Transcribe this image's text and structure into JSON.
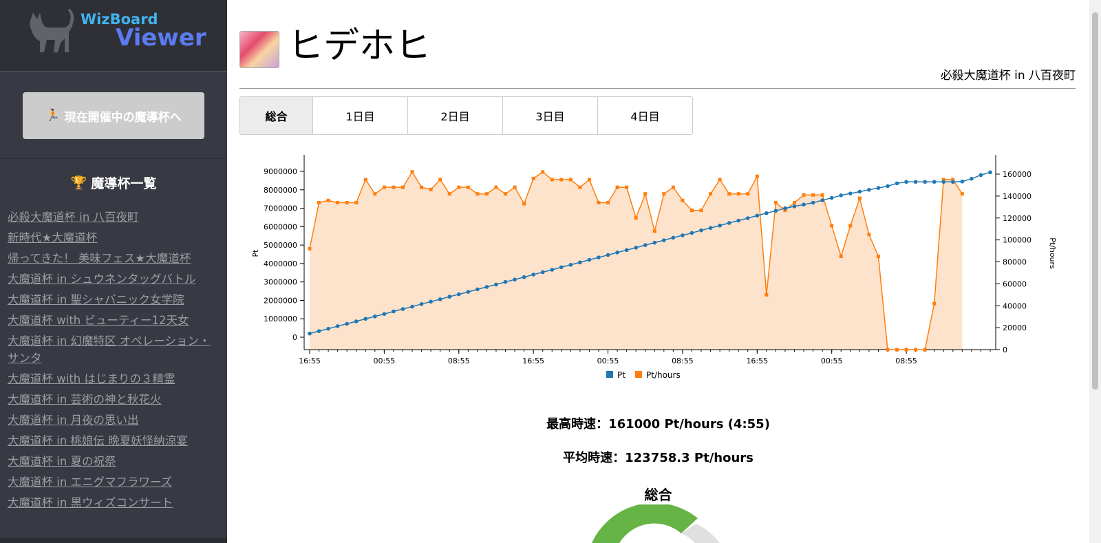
{
  "logo": {
    "line1": "WizBoard",
    "line2": "Viewer"
  },
  "sidebar": {
    "current_button": "現在開催中の魔導杯へ",
    "list_title": "魔導杯一覧",
    "items": [
      "必殺大魔道杯 in 八百夜町",
      "新時代★大魔道杯",
      "帰ってきた！ 美味フェス★大魔道杯",
      "大魔道杯 in シュウネンタッグバトル",
      "大魔道杯 in 聖シャバニック女学院",
      "大魔道杯 with ビューティー12天女",
      "大魔道杯 in 幻魔特区 オペレーション・サンタ",
      "大魔道杯 with はじまりの３精霊",
      "大魔道杯 in 芸術の神と秋花火",
      "大魔道杯 in 月夜の思い出",
      "大魔道杯 in 桃娘伝 晩夏妖怪納涼宴",
      "大魔道杯 in 夏の祝祭",
      "大魔道杯 in エニグマフラワーズ",
      "大魔道杯 in 黒ウィズコンサート"
    ]
  },
  "header": {
    "title": "ヒデホヒ",
    "event": "必殺大魔道杯 in 八百夜町"
  },
  "tabs": [
    "総合",
    "1日目",
    "2日目",
    "3日目",
    "4日目"
  ],
  "stats": {
    "max_speed": "最高時速：161000 Pt/hours (4:55)",
    "avg_speed": "平均時速：123758.3 Pt/hours"
  },
  "section_title": "総合",
  "colors": {
    "pt": "#1f77b4",
    "pth": "#ff7f0e",
    "area": "#fde2cc",
    "donut_green": "#66b346",
    "donut_gray": "#e0e0e0"
  },
  "chart_data": {
    "type": "line",
    "x_ticks": [
      "16:55",
      "00:55",
      "08:55",
      "16:55",
      "00:55",
      "08:55",
      "16:55",
      "00:55",
      "08:55"
    ],
    "x_tick_indices": [
      0,
      8,
      16,
      24,
      32,
      40,
      48,
      56,
      64
    ],
    "ylabel": "Pt",
    "y2label": "Pt/hours",
    "ylim": [
      0,
      9000000
    ],
    "y_ticks": [
      "0",
      "1000000",
      "2000000",
      "3000000",
      "4000000",
      "5000000",
      "6000000",
      "7000000",
      "8000000",
      "9000000"
    ],
    "y2lim": [
      0,
      160000
    ],
    "y2_ticks": [
      "0",
      "20000",
      "40000",
      "60000",
      "80000",
      "100000",
      "120000",
      "140000",
      "160000"
    ],
    "legend": [
      "Pt",
      "Pt/hours"
    ],
    "series": [
      {
        "name": "Pt",
        "axis": "left",
        "values": [
          200000,
          330000,
          460000,
          600000,
          730000,
          860000,
          1000000,
          1130000,
          1260000,
          1400000,
          1530000,
          1660000,
          1800000,
          1930000,
          2060000,
          2200000,
          2330000,
          2460000,
          2600000,
          2730000,
          2860000,
          3000000,
          3130000,
          3260000,
          3400000,
          3530000,
          3660000,
          3800000,
          3930000,
          4060000,
          4200000,
          4330000,
          4460000,
          4600000,
          4730000,
          4860000,
          5000000,
          5130000,
          5260000,
          5400000,
          5530000,
          5660000,
          5800000,
          5930000,
          6060000,
          6200000,
          6330000,
          6460000,
          6600000,
          6730000,
          6860000,
          7000000,
          7100000,
          7200000,
          7300000,
          7430000,
          7560000,
          7700000,
          7800000,
          7900000,
          8000000,
          8100000,
          8200000,
          8350000,
          8430000,
          8430000,
          8430000,
          8430000,
          8430000,
          8430000,
          8450000,
          8600000,
          8800000,
          8950000
        ]
      },
      {
        "name": "Pt/hours",
        "axis": "right",
        "values": [
          92000,
          134000,
          136000,
          134000,
          134000,
          134000,
          155000,
          142000,
          148000,
          148000,
          148000,
          162000,
          148000,
          146000,
          155000,
          142000,
          148000,
          148000,
          142000,
          142000,
          148000,
          142000,
          148000,
          133000,
          156000,
          162000,
          155000,
          155000,
          155000,
          148000,
          155000,
          134000,
          134000,
          148000,
          148000,
          120000,
          142000,
          108000,
          142000,
          148000,
          136000,
          127000,
          127000,
          142000,
          155000,
          142000,
          142000,
          142000,
          158000,
          50000,
          134000,
          127000,
          134000,
          141000,
          141000,
          141000,
          113000,
          85000,
          113000,
          138000,
          105000,
          85000,
          0,
          0,
          0,
          0,
          0,
          42000,
          155000,
          155000,
          142000
        ]
      }
    ]
  }
}
